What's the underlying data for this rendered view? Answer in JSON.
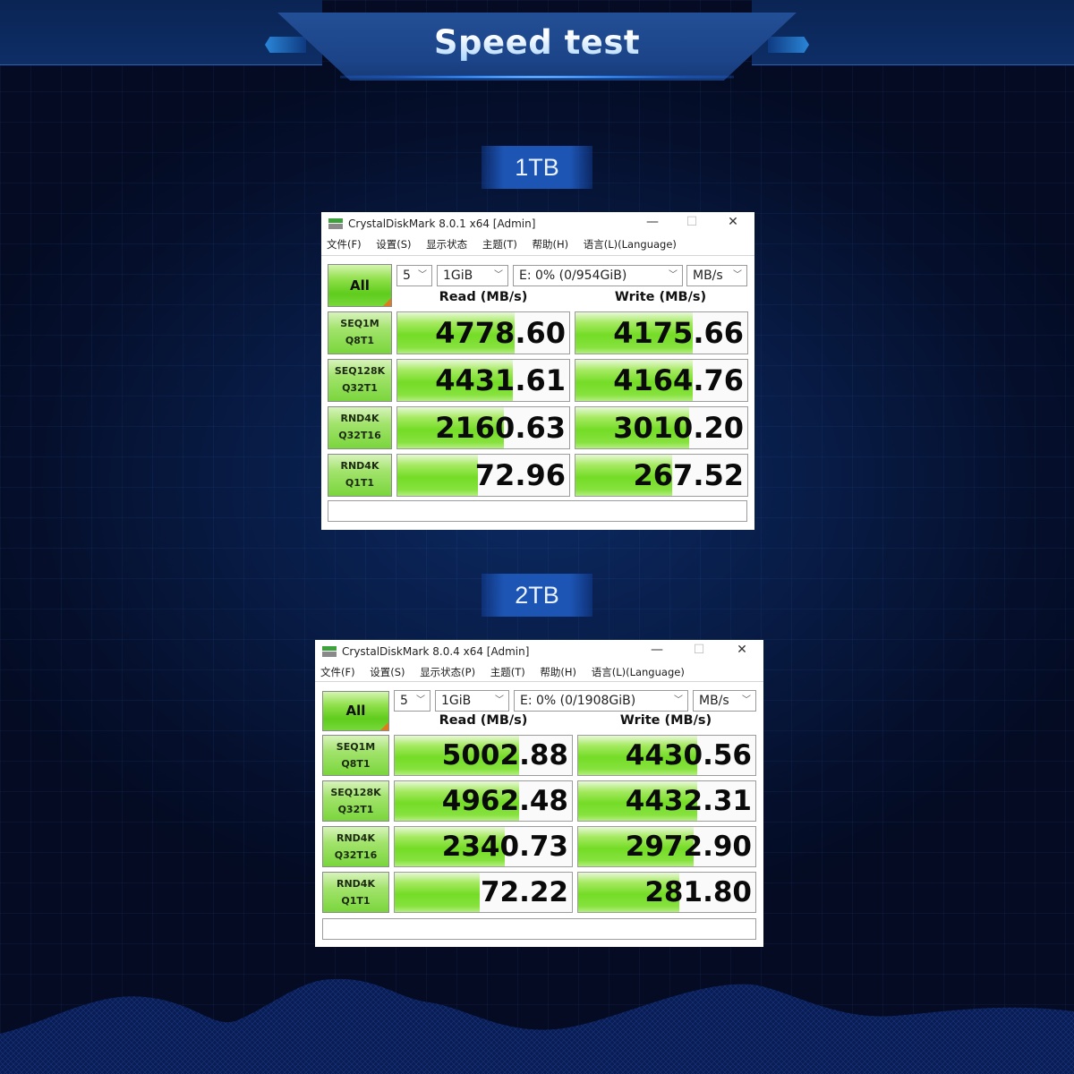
{
  "header": {
    "title": "Speed test"
  },
  "sections": [
    {
      "capacity_label": "1TB",
      "window": {
        "title": "CrystalDiskMark 8.0.1 x64 [Admin]",
        "controls": {
          "minimize": "—",
          "maximize": "☐",
          "close": "✕"
        },
        "menu": [
          "文件(F)",
          "设置(S)",
          "显示状态",
          "主题(T)",
          "帮助(H)",
          "语言(L)(Language)"
        ],
        "all_button": "All",
        "count": "5",
        "size": "1GiB",
        "drive": "E: 0% (0/954GiB)",
        "unit": "MB/s",
        "read_header": "Read (MB/s)",
        "write_header": "Write (MB/s)",
        "rows": [
          {
            "line1": "SEQ1M",
            "line2": "Q8T1",
            "read": "4778.60",
            "write": "4175.66",
            "read_fill": 0.68,
            "write_fill": 0.68
          },
          {
            "line1": "SEQ128K",
            "line2": "Q32T1",
            "read": "4431.61",
            "write": "4164.76",
            "read_fill": 0.67,
            "write_fill": 0.68
          },
          {
            "line1": "RND4K",
            "line2": "Q32T16",
            "read": "2160.63",
            "write": "3010.20",
            "read_fill": 0.62,
            "write_fill": 0.66
          },
          {
            "line1": "RND4K",
            "line2": "Q1T1",
            "read": "72.96",
            "write": "267.52",
            "read_fill": 0.47,
            "write_fill": 0.56
          }
        ],
        "status": ""
      }
    },
    {
      "capacity_label": "2TB",
      "window": {
        "title": "CrystalDiskMark 8.0.4 x64 [Admin]",
        "controls": {
          "minimize": "—",
          "maximize": "☐",
          "close": "✕"
        },
        "menu": [
          "文件(F)",
          "设置(S)",
          "显示状态(P)",
          "主题(T)",
          "帮助(H)",
          "语言(L)(Language)"
        ],
        "all_button": "All",
        "count": "5",
        "size": "1GiB",
        "drive": "E: 0% (0/1908GiB)",
        "unit": "MB/s",
        "read_header": "Read (MB/s)",
        "write_header": "Write (MB/s)",
        "rows": [
          {
            "line1": "SEQ1M",
            "line2": "Q8T1",
            "read": "5002.88",
            "write": "4430.56",
            "read_fill": 0.7,
            "write_fill": 0.67
          },
          {
            "line1": "SEQ128K",
            "line2": "Q32T1",
            "read": "4962.48",
            "write": "4432.31",
            "read_fill": 0.7,
            "write_fill": 0.67
          },
          {
            "line1": "RND4K",
            "line2": "Q32T16",
            "read": "2340.73",
            "write": "2972.90",
            "read_fill": 0.62,
            "write_fill": 0.65
          },
          {
            "line1": "RND4K",
            "line2": "Q1T1",
            "read": "72.22",
            "write": "281.80",
            "read_fill": 0.48,
            "write_fill": 0.57
          }
        ],
        "status": ""
      }
    }
  ]
}
